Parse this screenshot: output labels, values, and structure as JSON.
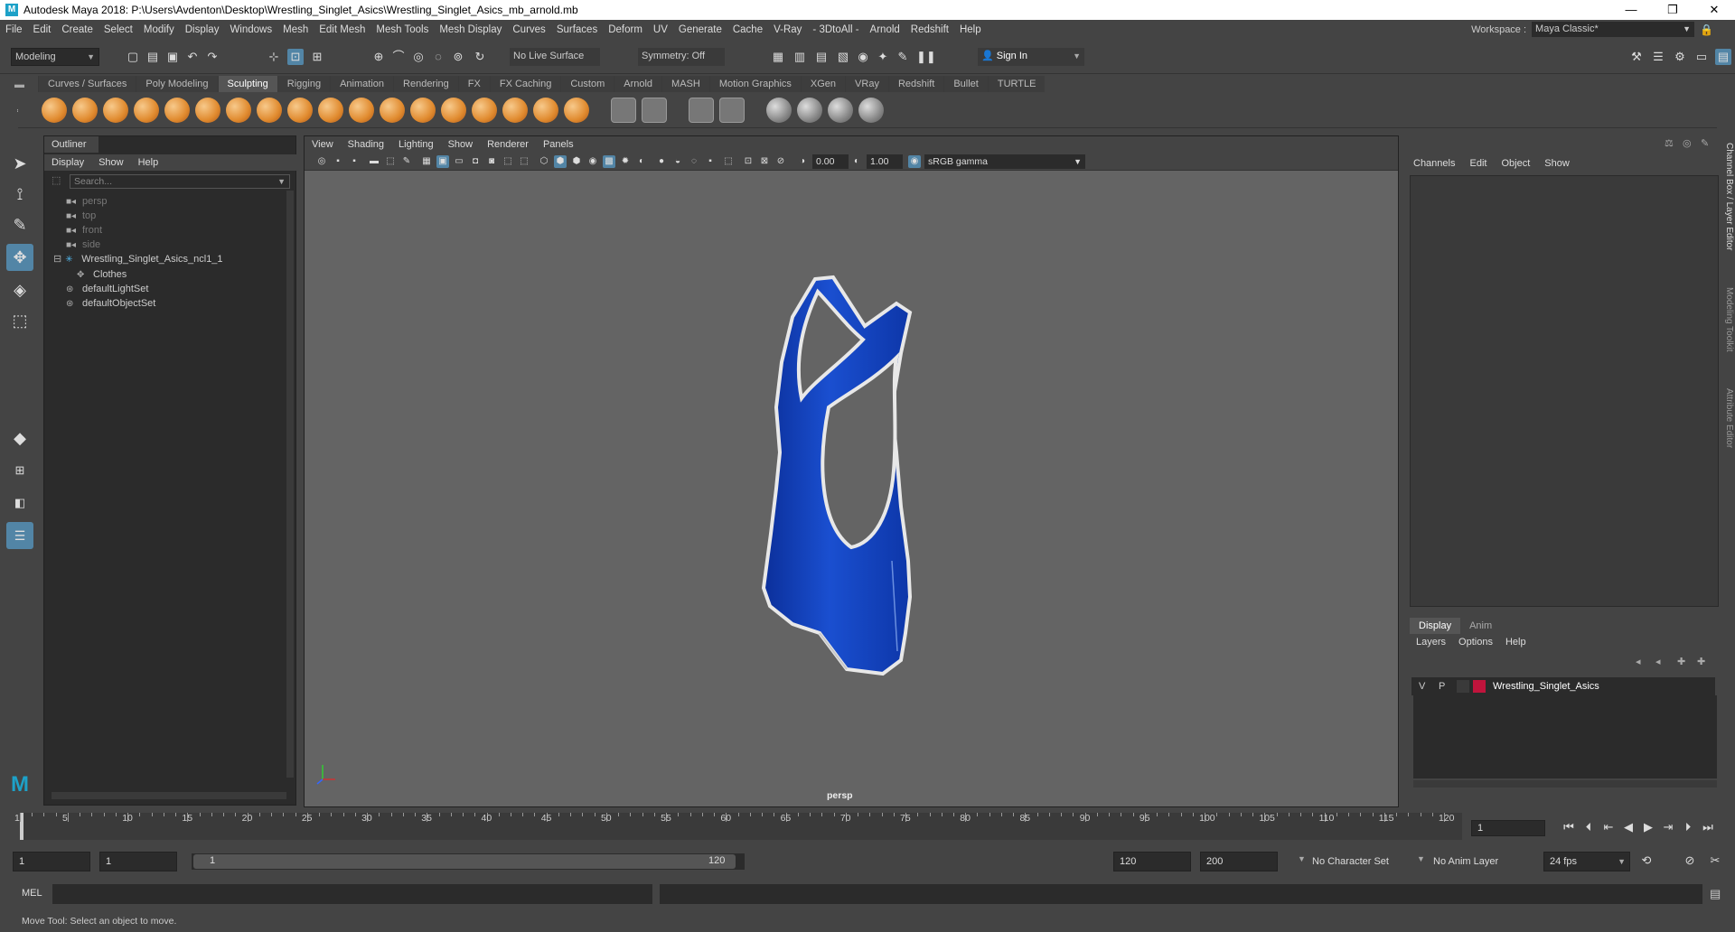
{
  "window": {
    "title": "Autodesk Maya 2018: P:\\Users\\Avdenton\\Desktop\\Wrestling_Singlet_Asics\\Wrestling_Singlet_Asics_mb_arnold.mb",
    "minimize": "—",
    "maximize": "❐",
    "close": "✕"
  },
  "menubar": {
    "items": [
      "File",
      "Edit",
      "Create",
      "Select",
      "Modify",
      "Display",
      "Windows",
      "Mesh",
      "Edit Mesh",
      "Mesh Tools",
      "Mesh Display",
      "Curves",
      "Surfaces",
      "Deform",
      "UV",
      "Generate",
      "Cache",
      "V-Ray",
      "- 3DtoAll -",
      "Arnold",
      "Redshift",
      "Help"
    ],
    "workspace_label": "Workspace :",
    "workspace_value": "Maya Classic*"
  },
  "statusline": {
    "menuset": "Modeling",
    "live_surface": "No Live Surface",
    "symmetry": "Symmetry: Off",
    "sign_in": "Sign In"
  },
  "shelf": {
    "tabs": [
      "Curves / Surfaces",
      "Poly Modeling",
      "Sculpting",
      "Rigging",
      "Animation",
      "Rendering",
      "FX",
      "FX Caching",
      "Custom",
      "Arnold",
      "MASH",
      "Motion Graphics",
      "XGen",
      "VRay",
      "Redshift",
      "Bullet",
      "TURTLE"
    ],
    "active_tab": "Sculpting"
  },
  "outliner": {
    "tab": "Outliner",
    "menu": [
      "Display",
      "Show",
      "Help"
    ],
    "search_placeholder": "Search...",
    "items": [
      {
        "label": "persp",
        "icon": "camera-icon",
        "dim": true
      },
      {
        "label": "top",
        "icon": "camera-icon",
        "dim": true
      },
      {
        "label": "front",
        "icon": "camera-icon",
        "dim": true
      },
      {
        "label": "side",
        "icon": "camera-icon",
        "dim": true
      },
      {
        "label": "Wrestling_Singlet_Asics_ncl1_1",
        "icon": "ncloth-icon",
        "dim": false
      },
      {
        "label": "Clothes",
        "icon": "transform-icon",
        "dim": false
      },
      {
        "label": "defaultLightSet",
        "icon": "set-icon",
        "dim": false
      },
      {
        "label": "defaultObjectSet",
        "icon": "set-icon",
        "dim": false
      }
    ]
  },
  "viewport": {
    "menu": [
      "View",
      "Shading",
      "Lighting",
      "Show",
      "Renderer",
      "Panels"
    ],
    "exposure": "0.00",
    "gamma": "1.00",
    "color_space": "sRGB gamma",
    "camera_label": "persp",
    "singlet_color": "#1a4fd0"
  },
  "channelbox": {
    "menu": [
      "Channels",
      "Edit",
      "Object",
      "Show"
    ],
    "layer_tabs": [
      "Display",
      "Anim"
    ],
    "layer_menu": [
      "Layers",
      "Options",
      "Help"
    ],
    "layer": {
      "v": "V",
      "p": "P",
      "name": "Wrestling_Singlet_Asics",
      "color": "#c0143c"
    },
    "side_tabs": [
      "Channel Box / Layer Editor",
      "Modeling Toolkit",
      "Attribute Editor"
    ]
  },
  "timeslider": {
    "ticks": [
      "1",
      "5",
      "10",
      "15",
      "20",
      "25",
      "30",
      "35",
      "40",
      "45",
      "50",
      "55",
      "60",
      "65",
      "70",
      "75",
      "80",
      "85",
      "90",
      "95",
      "100",
      "105",
      "110",
      "115",
      "120"
    ],
    "current_frame": "1"
  },
  "range": {
    "start": "1",
    "start_inner": "1",
    "range_start_label": "1",
    "range_end_label": "120",
    "end_inner": "120",
    "end": "200",
    "character_set": "No Character Set",
    "anim_layer": "No Anim Layer",
    "fps": "24 fps"
  },
  "cmdline": {
    "label": "MEL"
  },
  "helpline": {
    "text": "Move Tool: Select an object to move."
  }
}
